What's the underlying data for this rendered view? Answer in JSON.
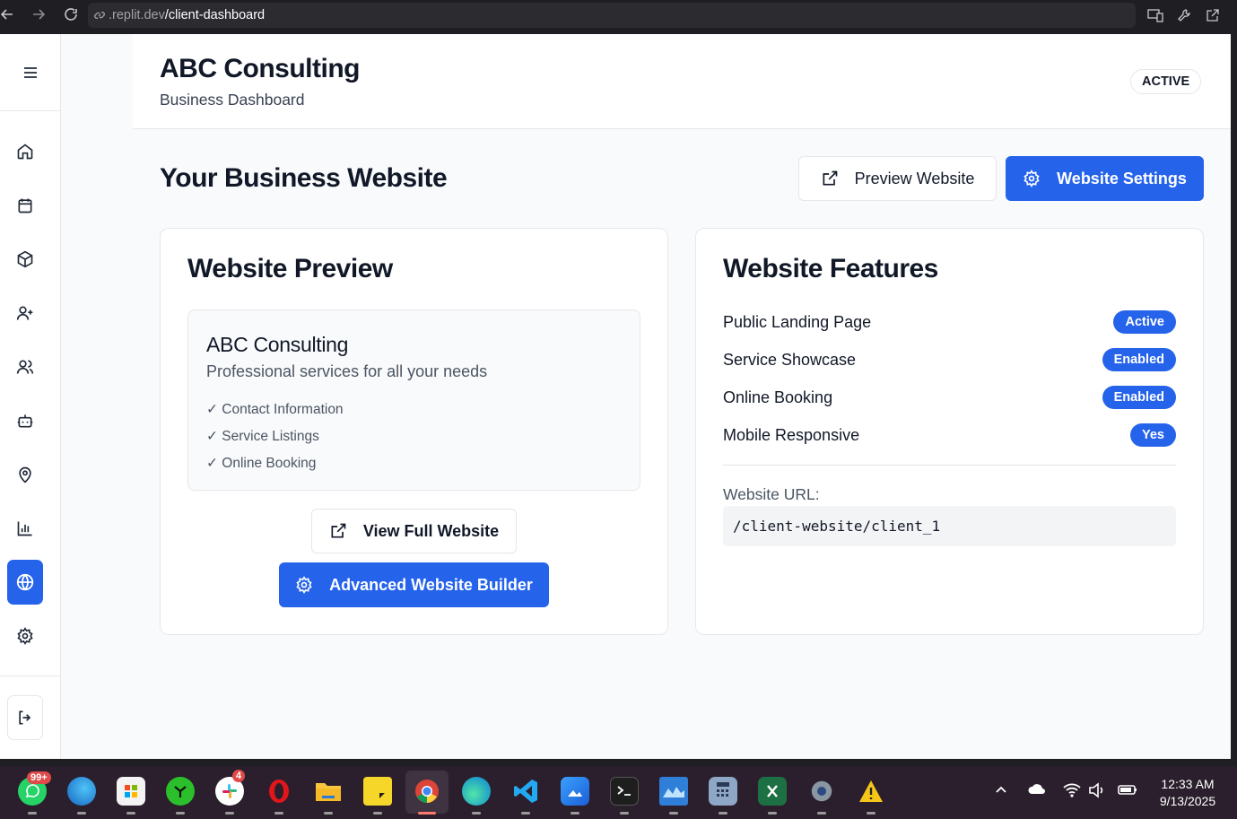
{
  "browser": {
    "url_prefix": ".replit.dev",
    "url_path": "/client-dashboard"
  },
  "header": {
    "title": "ABC Consulting",
    "subtitle": "Business Dashboard",
    "status_badge": "ACTIVE"
  },
  "sidebar": {
    "menu_icon": "hamburger-menu-icon",
    "items": [
      {
        "icon": "home-icon"
      },
      {
        "icon": "calendar-icon"
      },
      {
        "icon": "package-icon"
      },
      {
        "icon": "user-plus-icon"
      },
      {
        "icon": "users-icon"
      },
      {
        "icon": "bot-icon"
      },
      {
        "icon": "map-pin-icon"
      },
      {
        "icon": "bar-chart-icon"
      },
      {
        "icon": "globe-icon",
        "active": true
      },
      {
        "icon": "settings-icon"
      }
    ],
    "logout_icon": "log-out-icon"
  },
  "page": {
    "title": "Your Business Website",
    "preview_button": "Preview Website",
    "settings_button": "Website Settings"
  },
  "preview_card": {
    "title": "Website Preview",
    "mini_title": "ABC Consulting",
    "mini_subtitle": "Professional services for all your needs",
    "features": [
      "✓ Contact Information",
      "✓ Service Listings",
      "✓ Online Booking"
    ],
    "view_full_button": "View Full Website",
    "builder_button": "Advanced Website Builder"
  },
  "features_card": {
    "title": "Website Features",
    "rows": [
      {
        "label": "Public Landing Page",
        "status": "Active"
      },
      {
        "label": "Service Showcase",
        "status": "Enabled"
      },
      {
        "label": "Online Booking",
        "status": "Enabled"
      },
      {
        "label": "Mobile Responsive",
        "status": "Yes"
      }
    ],
    "url_label": "Website URL:",
    "url_value": "/client-website/client_1"
  },
  "taskbar": {
    "whatsapp_badge": "99+",
    "slack_badge": "4",
    "time": "12:33 AM",
    "date": "9/13/2025"
  },
  "colors": {
    "primary": "#2563eb",
    "text": "#111827",
    "border": "#e5e7eb",
    "background": "#f9fafb"
  }
}
